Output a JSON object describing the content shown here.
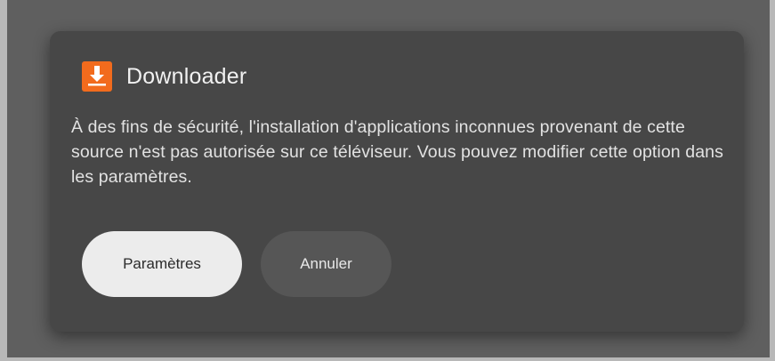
{
  "dialog": {
    "app_icon": "downloader-app-icon",
    "title": "Downloader",
    "message": "À des fins de sécurité, l'installation d'applications inconnues provenant de cette source n'est pas autorisée sur ce téléviseur. Vous pouvez modifier cette option dans les paramètres.",
    "buttons": {
      "primary_label": "Paramètres",
      "secondary_label": "Annuler"
    }
  },
  "colors": {
    "backdrop": "#5f5f5f",
    "dialog_background": "#474747",
    "app_icon_orange": "#f26b1d",
    "primary_button": "#ececec",
    "secondary_button": "#565656"
  }
}
